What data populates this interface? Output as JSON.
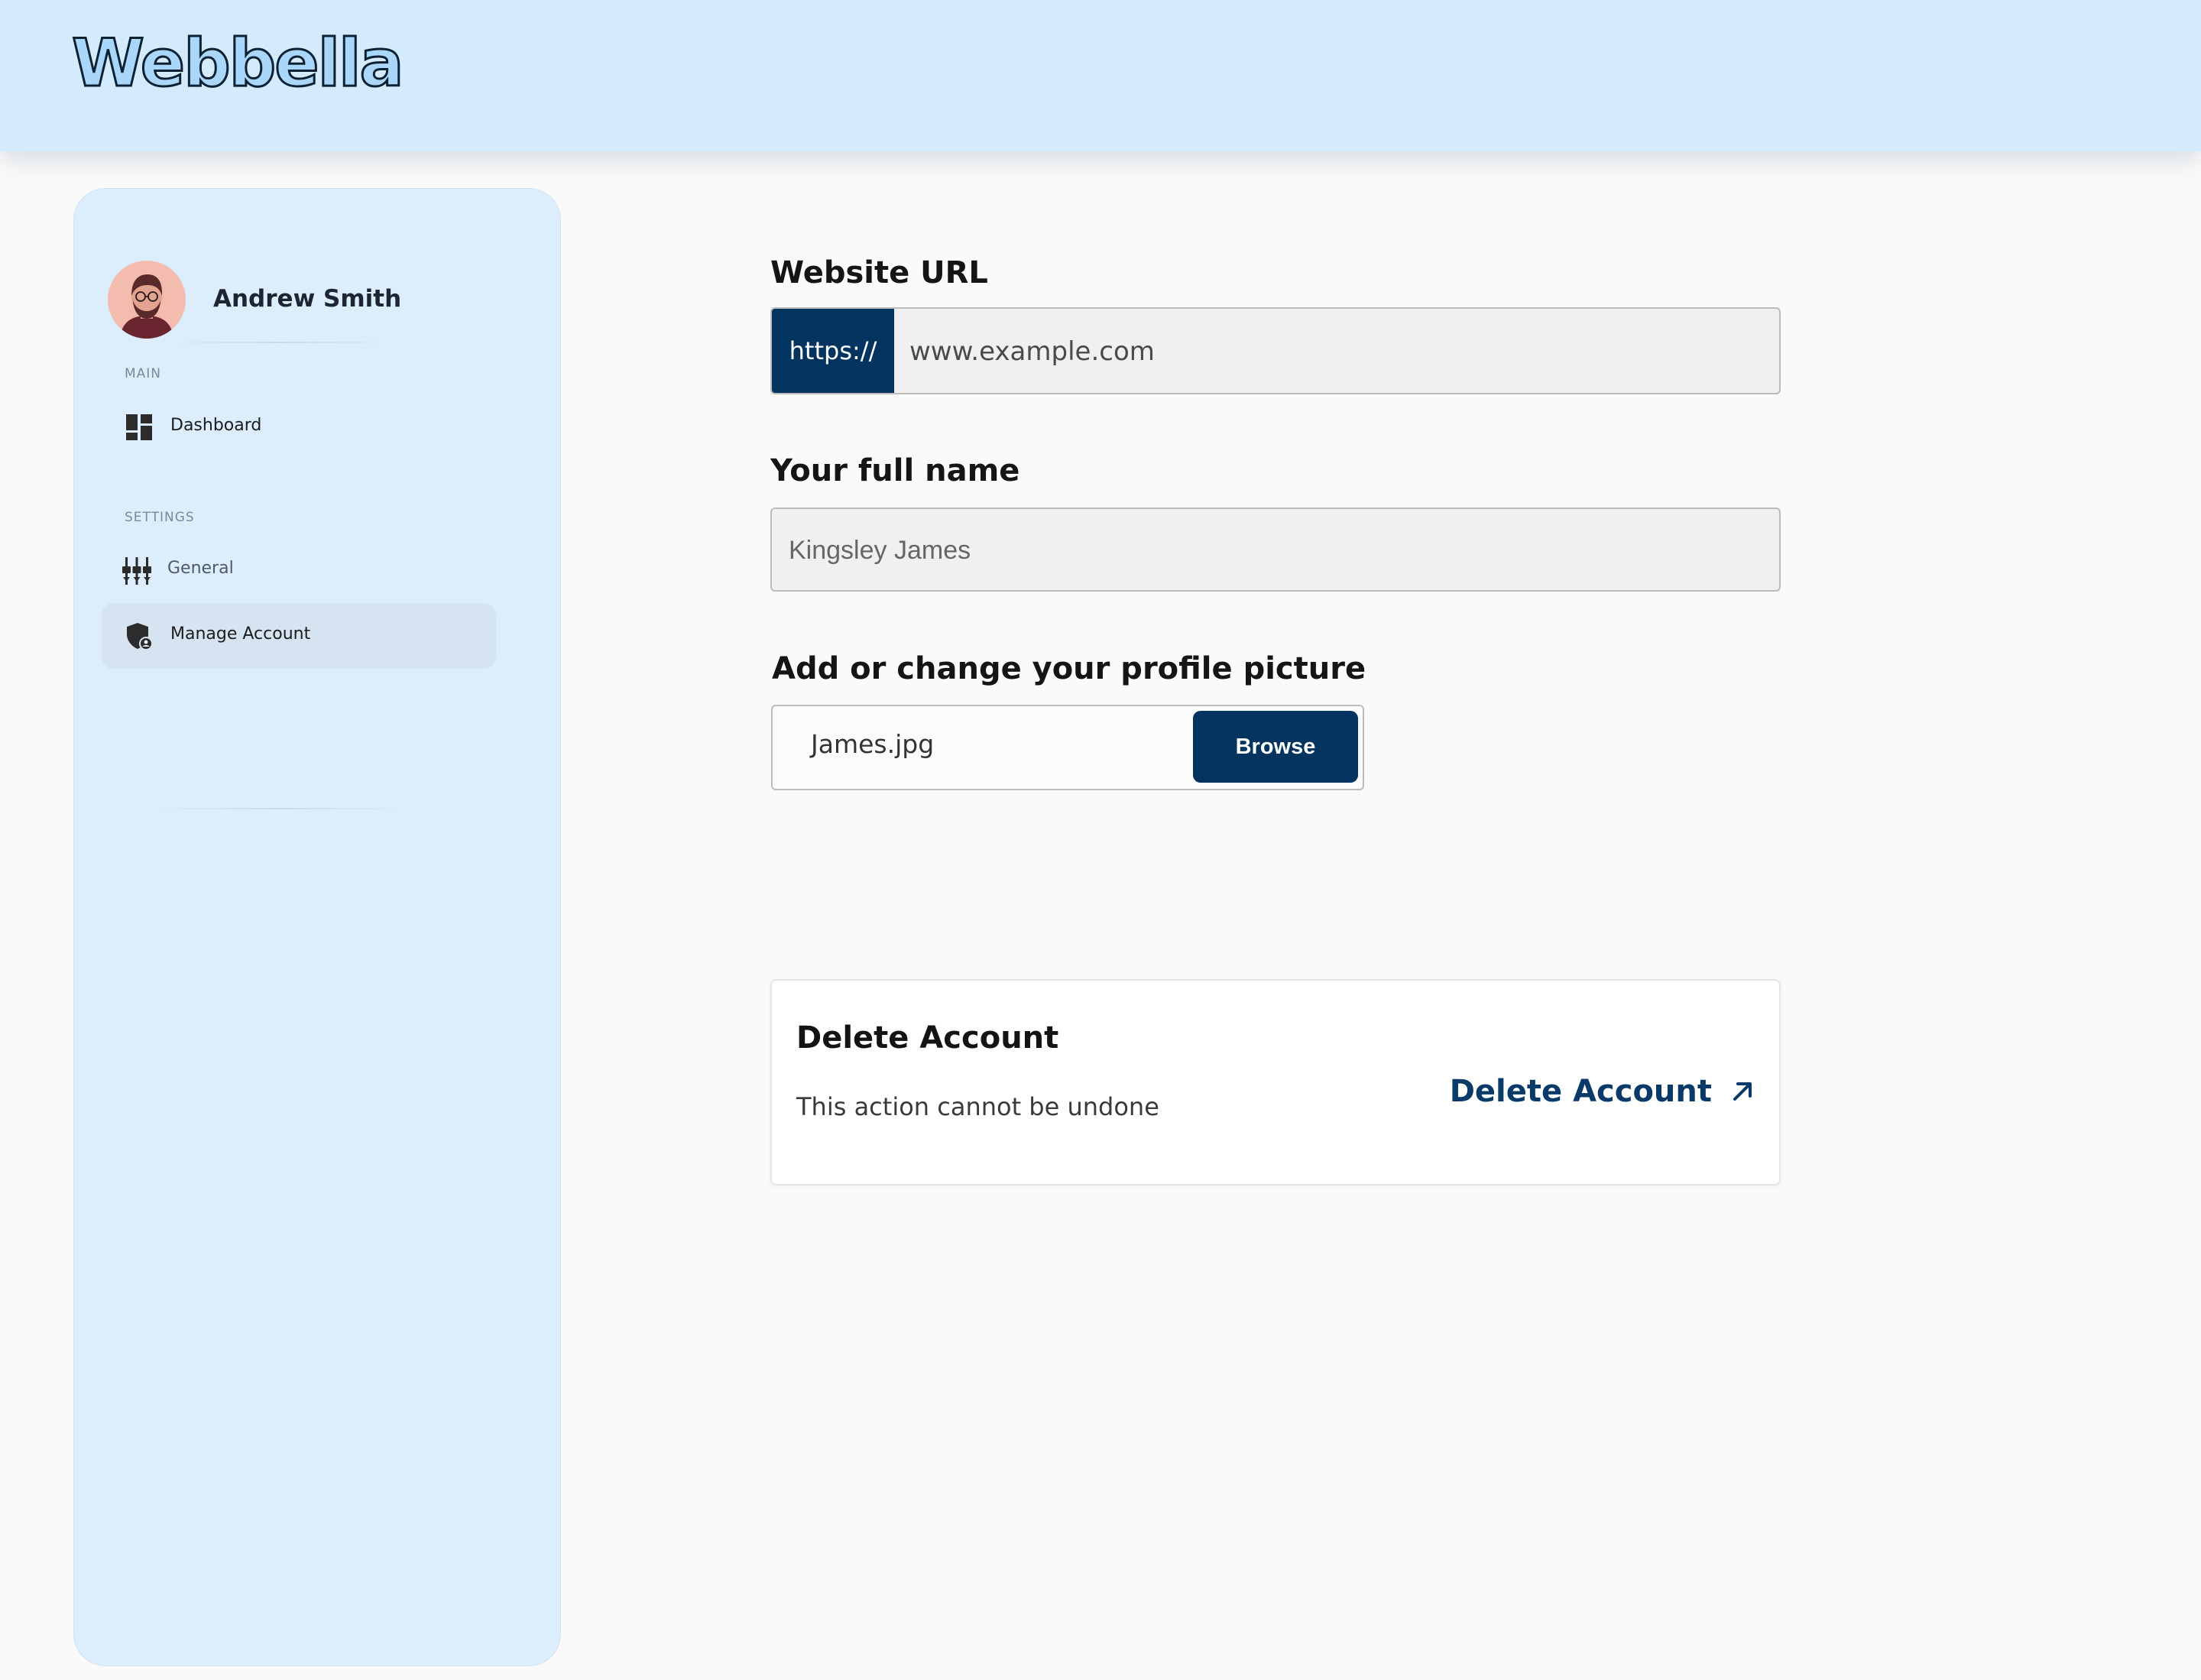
{
  "brand": {
    "logo_text": "Webbella"
  },
  "sidebar": {
    "user_name": "Andrew Smith",
    "sections": [
      {
        "label": "MAIN",
        "items": [
          {
            "label": "Dashboard",
            "icon": "dashboard-icon",
            "active": false
          }
        ]
      },
      {
        "label": "SETTINGS",
        "items": [
          {
            "label": "General",
            "icon": "sliders-icon",
            "active": false
          },
          {
            "label": "Manage Account",
            "icon": "shield-user-icon",
            "active": true
          }
        ]
      }
    ]
  },
  "form": {
    "website": {
      "label": "Website URL",
      "prefix": "https://",
      "placeholder": "www.example.com"
    },
    "full_name": {
      "label": "Your full name",
      "placeholder": "Kingsley James"
    },
    "profile_picture": {
      "label": "Add or change your profile picture",
      "file_name": "James.jpg",
      "browse_label": "Browse"
    }
  },
  "danger_zone": {
    "title": "Delete Account",
    "description": "This action cannot be undone",
    "action_label": "Delete Account",
    "action_icon": "arrow-up-right-icon"
  },
  "colors": {
    "header_bg": "#d4eafd",
    "sidebar_bg": "#dceefe",
    "primary": "#03335f",
    "page_bg": "#fafafa"
  }
}
